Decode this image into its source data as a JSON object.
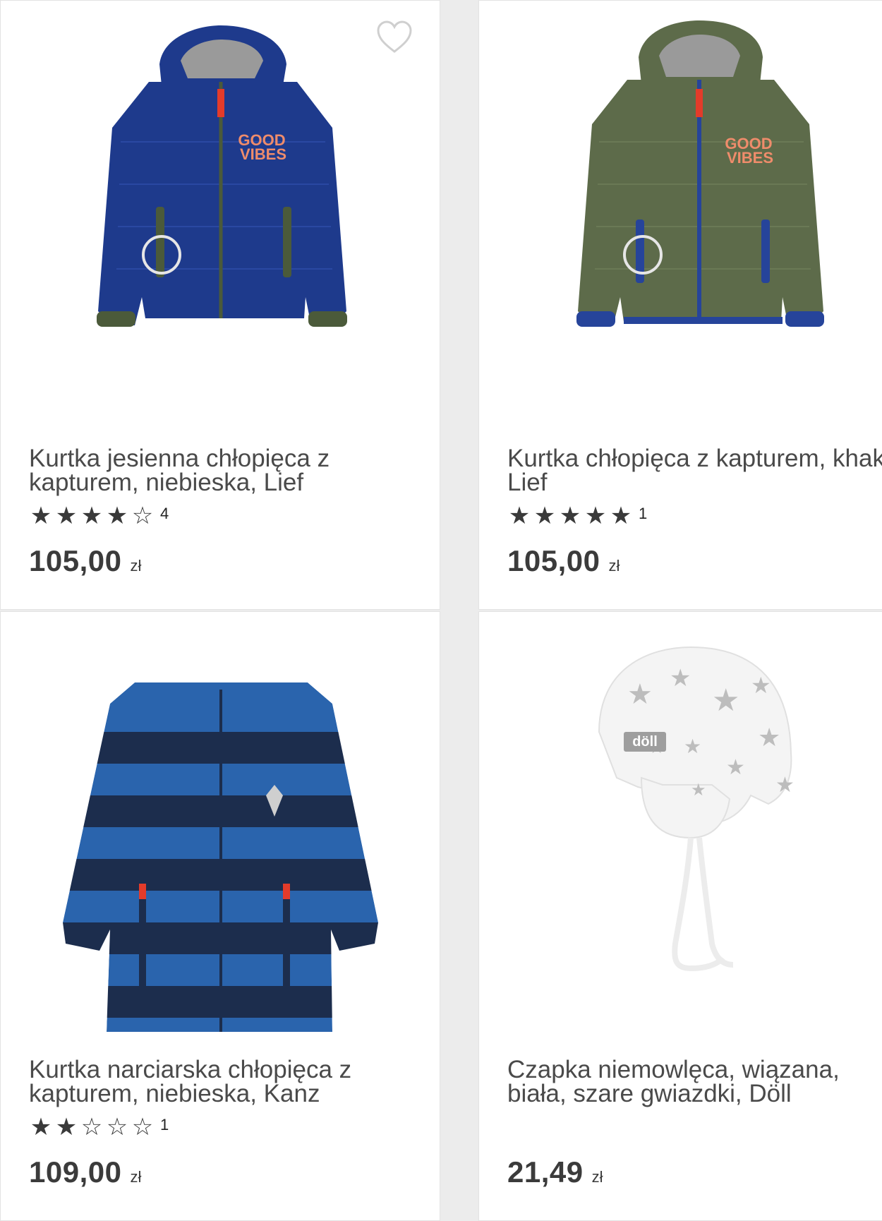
{
  "products": [
    {
      "title_line1": "Kurtka jesienna chłopięca z",
      "title_line2": "kapturem, niebieska, Lief",
      "rating_stars": 4,
      "rating_count": "4",
      "price": "105,00",
      "currency": "zł",
      "image_label": "GOOD VIBES",
      "colors": {
        "body": "#1e3a8c",
        "cuff": "#4b5a3a"
      }
    },
    {
      "title_line1": "Kurtka chłopięca z kapturem, khaki,",
      "title_line2": "Lief",
      "rating_stars": 5,
      "rating_count": "1",
      "price": "105,00",
      "currency": "zł",
      "image_label": "GOOD VIBES",
      "colors": {
        "body": "#5d6b4a",
        "cuff": "#26449a"
      }
    },
    {
      "title_line1": "Kurtka narciarska chłopięca z",
      "title_line2": "kapturem, niebieska, Kanz",
      "rating_stars": 2,
      "rating_count": "1",
      "price": "109,00",
      "currency": "zł",
      "colors": {
        "stripe_a": "#2a64ad",
        "stripe_b": "#1c2d4d",
        "accent": "#e33b2a"
      }
    },
    {
      "title_line1": "Czapka niemowlęca, wiązana,",
      "title_line2": "biała, szare gwiazdki, Döll",
      "rating_stars": 0,
      "rating_count": "",
      "price": "21,49",
      "currency": "zł",
      "image_label": "döll",
      "colors": {
        "body": "#f4f4f4",
        "star": "#b5b5b5"
      }
    }
  ],
  "icons": {
    "favorite": "heart-outline-icon",
    "star_full": "★",
    "star_empty": "☆"
  }
}
